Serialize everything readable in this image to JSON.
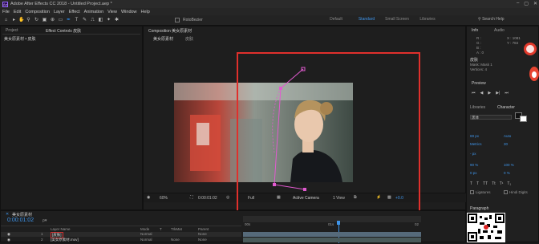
{
  "app": {
    "title": "Adobe After Effects CC 2018 - Untitled Project.aep *"
  },
  "menu": [
    "File",
    "Edit",
    "Composition",
    "Layer",
    "Effect",
    "Animation",
    "View",
    "Window",
    "Help"
  ],
  "toolbar": {
    "rotobezier": "RotoBezier"
  },
  "workspaces": [
    "Default",
    "Standard",
    "Small Screen",
    "Libraries"
  ],
  "search_help": {
    "placeholder": "Search Help"
  },
  "left_panel": {
    "tabs": [
      "Project",
      "Effect Controls 皮肤"
    ],
    "header": "美女原素材 • 皮肤"
  },
  "composition": {
    "tab": "Composition 美女原素材",
    "crumbs": [
      "美女原素材",
      "皮肤"
    ],
    "zoom": "60%",
    "timecode": "0:00:01:02",
    "resolution": "Full",
    "camera": "Active Camera",
    "view": "1 View",
    "exposure": "+0.0"
  },
  "info_panel": {
    "tabs": [
      "Info",
      "Audio"
    ],
    "rgba": [
      "R :",
      "G :",
      "B :",
      "A : 0"
    ],
    "xy": [
      "X : 1081",
      "Y : 784"
    ],
    "layer_name": "皮肤",
    "mask": "Mask: Mask 1",
    "vertices": "Vertices: 4"
  },
  "preview_panel": {
    "title": "Preview"
  },
  "libraries_tab": "Libraries",
  "character_panel": {
    "title": "Character",
    "font": "黑体",
    "size": "69 px",
    "leading": "Auto",
    "kerning": "Metrics",
    "tracking": "30",
    "stroke": "- px",
    "vscale": "90 %",
    "hscale": "100 %",
    "baseline": "0 px",
    "tsume": "0 %",
    "ligatures": "Ligatures",
    "hindi": "Hindi Digits"
  },
  "timeline": {
    "tab": "美女原素材",
    "timecode": "0:00:01:02",
    "search_placeholder": "ρ▾",
    "columns": [
      "Layer Name",
      "Mode",
      "T",
      "TrkMat",
      "Parent"
    ],
    "rows": [
      {
        "num": "1",
        "name": "[皮肤]",
        "mode": "Normal",
        "trk": "",
        "parent": "None"
      },
      {
        "num": "2",
        "name": "[美女原素材.mov]",
        "mode": "Normal",
        "trk": "None",
        "parent": "None"
      }
    ],
    "ruler": [
      "00s",
      "01s",
      "02"
    ],
    "paragraph": "Paragraph"
  },
  "colors": {
    "accent": "#2d8ceb",
    "selection_box": "#e0302c",
    "mask_path": "#e25ad0"
  }
}
